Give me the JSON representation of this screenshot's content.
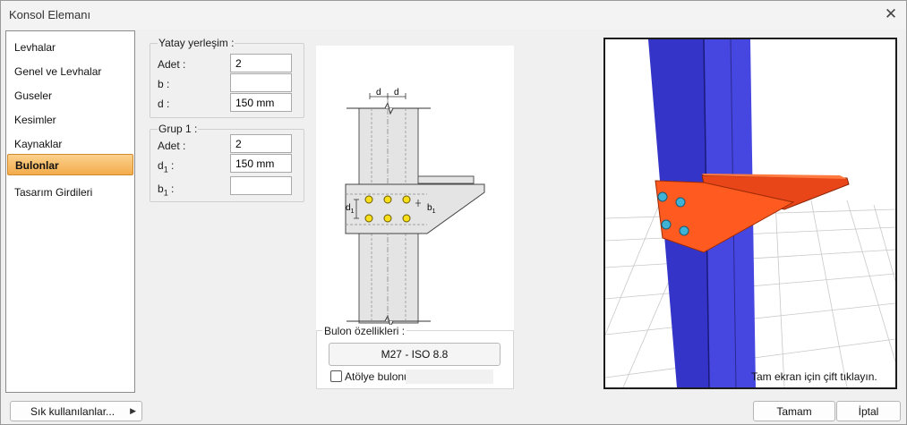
{
  "window": {
    "title": "Konsol Elemanı"
  },
  "sidebar": {
    "items": [
      {
        "label": "Levhalar"
      },
      {
        "label": "Genel ve Levhalar"
      },
      {
        "label": "Guseler"
      },
      {
        "label": "Kesimler"
      },
      {
        "label": "Kaynaklar"
      },
      {
        "label": "Bulonlar",
        "active": true
      },
      {
        "label": "Tasarım Girdileri"
      }
    ]
  },
  "horizontal_layout": {
    "legend": "Yatay yerleşim :",
    "count_label": "Adet :",
    "count_value": "2",
    "b_label": "b :",
    "b_value": "",
    "d_label": "d :",
    "d_value": "150 mm"
  },
  "group1": {
    "legend": "Grup 1 :",
    "count_label": "Adet :",
    "count_value": "2",
    "d1_label": "d",
    "d1_sub": "1",
    "d1_colon": " :",
    "d1_value": "150 mm",
    "b1_label": "b",
    "b1_sub": "1",
    "b1_colon": " :",
    "b1_value": ""
  },
  "drawing": {
    "dim_d": "d",
    "dim_d1": "d",
    "dim_d1_sub": "1",
    "dim_b1": "b",
    "dim_b1_sub": "1",
    "dim_b": "b"
  },
  "bolt_properties": {
    "legend": "Bulon özellikleri :",
    "bolt_type": "M27 - ISO 8.8",
    "shop_bolt_label": "Atölye bulonu",
    "shop_bolt_checked": false
  },
  "view3d": {
    "hint": "Tam ekran için çift tıklayın."
  },
  "footer": {
    "favorites_label": "Sık kullanılanlar...",
    "ok_label": "Tamam",
    "cancel_label": "İptal"
  },
  "colors": {
    "active_item": "#f3ac4b",
    "column": "#3f3fcc",
    "plate": "#ff5a1f",
    "bolt": "#3fb2d6",
    "bolt_2d": "#f7e019"
  }
}
